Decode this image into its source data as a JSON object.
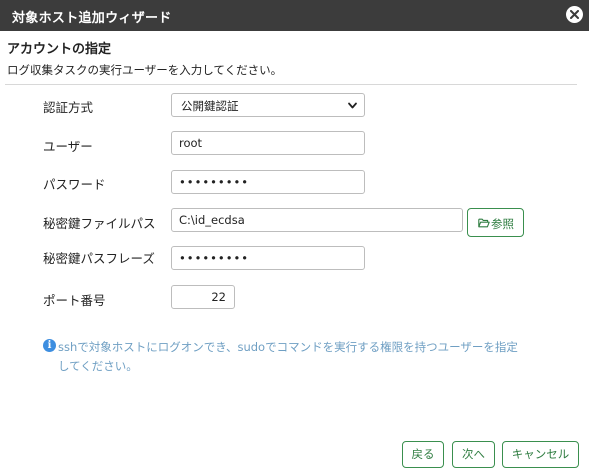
{
  "window": {
    "title": "対象ホスト追加ウィザード"
  },
  "header": {
    "heading": "アカウントの指定",
    "description": "ログ収集タスクの実行ユーザーを入力してください。"
  },
  "form": {
    "auth_method": {
      "label": "認証方式",
      "value": "公開鍵認証"
    },
    "user": {
      "label": "ユーザー",
      "value": "root"
    },
    "password": {
      "label": "パスワード",
      "value": "•••••••••"
    },
    "key_file": {
      "label": "秘密鍵ファイルパス",
      "value": "C:\\id_ecdsa",
      "browse_label": "参照"
    },
    "key_passphrase": {
      "label": "秘密鍵パスフレーズ",
      "value": "•••••••••"
    },
    "port": {
      "label": "ポート番号",
      "value": "22"
    }
  },
  "info": {
    "icon": "info-icon",
    "text": "sshで対象ホストにログオンでき、sudoでコマンドを実行する権限を持つユーザーを指定してください。"
  },
  "footer": {
    "back_label": "戻る",
    "next_label": "次へ",
    "cancel_label": "キャンセル"
  },
  "colors": {
    "titlebar": "#3c3c3c",
    "accent_green": "#2f7d41",
    "info_blue": "#3d8ee0",
    "info_text": "#6f9fc3"
  }
}
